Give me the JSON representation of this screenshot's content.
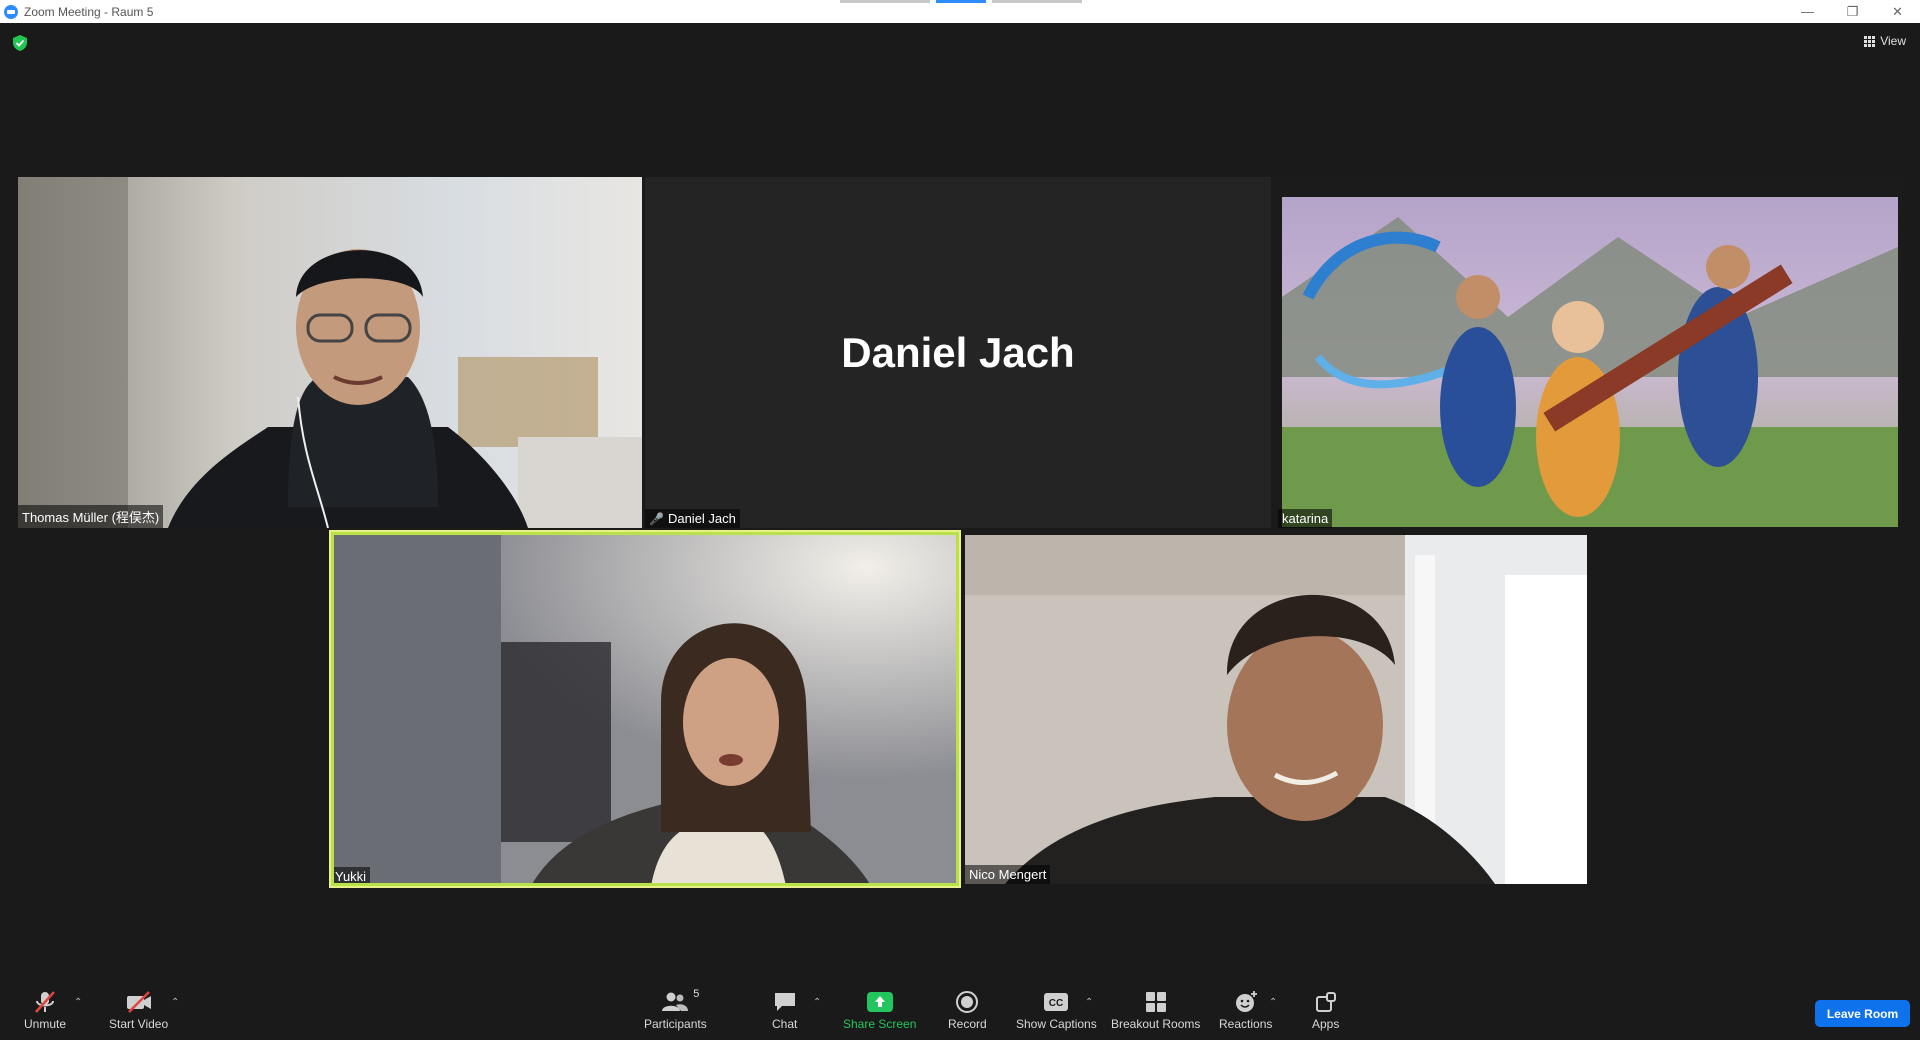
{
  "window": {
    "title": "Zoom Meeting - Raum 5"
  },
  "top_bar": {
    "view_label": "View"
  },
  "participants": [
    {
      "name": "Thomas Müller (程俣杰)",
      "video": "on",
      "muted": false
    },
    {
      "name": "Daniel Jach",
      "video": "off",
      "muted": true,
      "center_name": "Daniel Jach"
    },
    {
      "name": "katarina",
      "video": "on",
      "muted": false
    },
    {
      "name": "Yukki",
      "video": "on",
      "muted": false,
      "active_speaker": true
    },
    {
      "name": "Nico Mengert",
      "video": "on",
      "muted": false
    }
  ],
  "toolbar": {
    "unmute": "Unmute",
    "start_video": "Start Video",
    "participants": "Participants",
    "participants_count": "5",
    "chat": "Chat",
    "share_screen": "Share Screen",
    "record": "Record",
    "show_captions": "Show Captions",
    "breakout_rooms": "Breakout Rooms",
    "reactions": "Reactions",
    "apps": "Apps",
    "leave_room": "Leave Room"
  },
  "colors": {
    "background": "#1a1a1a",
    "share_green": "#22c55e",
    "leave_blue": "#0e72ed",
    "muted_red": "#e0443e",
    "active_border": "#d7ec7a"
  }
}
